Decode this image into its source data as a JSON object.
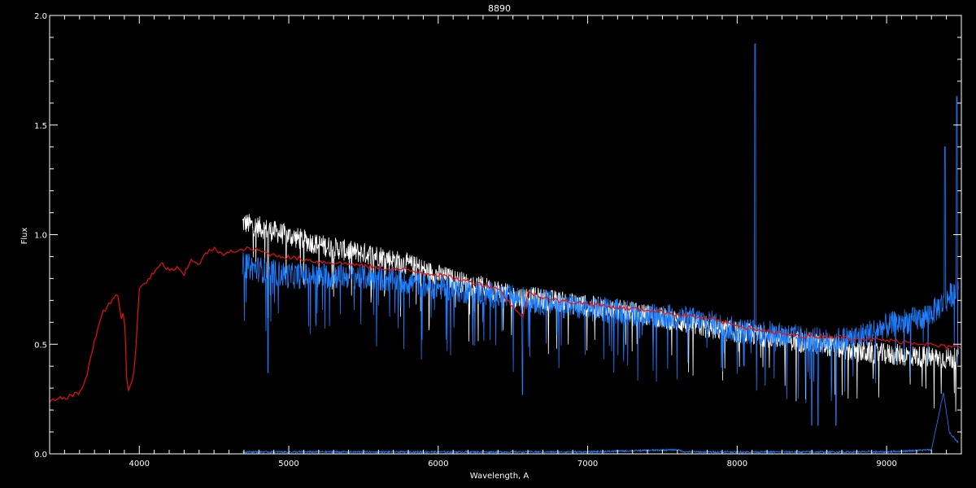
{
  "chart_data": {
    "type": "line",
    "title": "8890",
    "xlabel": "Wavelength, A",
    "ylabel": "Flux",
    "xlim": [
      3400,
      9500
    ],
    "ylim": [
      0.0,
      2.0
    ],
    "x_ticks": [
      "4000",
      "5000",
      "6000",
      "7000",
      "8000",
      "9000"
    ],
    "y_ticks": [
      "0.0",
      "0.5",
      "1.0",
      "1.5",
      "2.0"
    ],
    "grid": false,
    "background_color": "#000000",
    "foreground_color": "#ffffff",
    "series": [
      {
        "key": "white",
        "color": "#ffffff",
        "x": [
          4690,
          4800,
          5000,
          5200,
          5400,
          5600,
          5800,
          6000,
          6200,
          6400,
          6500,
          6600,
          6700,
          6800,
          7000,
          7200,
          7400,
          7600,
          7800,
          8000,
          8200,
          8400,
          8600,
          8800,
          9000,
          9200,
          9400,
          9480
        ],
        "y": [
          1.07,
          1.05,
          1.01,
          0.97,
          0.94,
          0.92,
          0.88,
          0.83,
          0.79,
          0.76,
          0.73,
          0.73,
          0.72,
          0.71,
          0.69,
          0.67,
          0.65,
          0.62,
          0.59,
          0.57,
          0.55,
          0.53,
          0.51,
          0.48,
          0.47,
          0.46,
          0.45,
          0.45
        ],
        "noise": 0.05,
        "dips": [
          [
            4861,
            0.62
          ],
          [
            6563,
            0.64
          ]
        ]
      },
      {
        "key": "blue",
        "color": "#1e7fff",
        "x": [
          4690,
          4800,
          5000,
          5200,
          5400,
          5600,
          5800,
          6000,
          6200,
          6400,
          6600,
          6800,
          7000,
          7200,
          7400,
          7600,
          7800,
          8000,
          8200,
          8400,
          8600,
          8800,
          9000,
          9100,
          9200,
          9300,
          9400,
          9480
        ],
        "y": [
          0.88,
          0.86,
          0.83,
          0.83,
          0.83,
          0.82,
          0.8,
          0.78,
          0.76,
          0.74,
          0.72,
          0.7,
          0.68,
          0.67,
          0.65,
          0.64,
          0.62,
          0.58,
          0.57,
          0.55,
          0.53,
          0.55,
          0.6,
          0.62,
          0.63,
          0.66,
          0.72,
          0.78
        ],
        "noise": 0.06,
        "dips": [
          [
            4861,
            0.37
          ],
          [
            6563,
            0.27
          ],
          [
            8498,
            0.13
          ],
          [
            8542,
            0.13
          ],
          [
            8662,
            0.13
          ]
        ],
        "spikes": [
          [
            8120,
            1.87
          ],
          [
            9390,
            1.4
          ],
          [
            9470,
            1.63
          ]
        ]
      },
      {
        "key": "red",
        "color": "#e81010",
        "x": [
          3400,
          3500,
          3600,
          3650,
          3700,
          3750,
          3800,
          3850,
          3880,
          3900,
          3920,
          3950,
          3970,
          4000,
          4050,
          4100,
          4150,
          4200,
          4250,
          4300,
          4350,
          4400,
          4450,
          4500,
          4550,
          4600,
          4650,
          4700,
          4800,
          4900,
          5000,
          5200,
          5400,
          5600,
          5800,
          6000,
          6200,
          6400,
          6563,
          6600,
          6800,
          7000,
          7200,
          7400,
          7600,
          7800,
          8000,
          8200,
          8400,
          8600,
          8800,
          9000,
          9200,
          9400,
          9500
        ],
        "y": [
          0.24,
          0.26,
          0.28,
          0.36,
          0.52,
          0.64,
          0.69,
          0.74,
          0.62,
          0.66,
          0.27,
          0.33,
          0.4,
          0.76,
          0.79,
          0.83,
          0.87,
          0.84,
          0.85,
          0.82,
          0.89,
          0.87,
          0.92,
          0.94,
          0.91,
          0.93,
          0.92,
          0.94,
          0.93,
          0.91,
          0.9,
          0.88,
          0.87,
          0.85,
          0.84,
          0.82,
          0.79,
          0.76,
          0.62,
          0.74,
          0.7,
          0.69,
          0.67,
          0.66,
          0.64,
          0.62,
          0.59,
          0.56,
          0.54,
          0.54,
          0.53,
          0.52,
          0.51,
          0.49,
          0.49
        ],
        "noise": 0.01
      },
      {
        "key": "baseline",
        "color": "#1e7fff",
        "x": [
          4690,
          5000,
          6000,
          7000,
          7600,
          7650,
          8000,
          9000,
          9300,
          9380,
          9420,
          9480
        ],
        "y": [
          0.01,
          0.01,
          0.01,
          0.01,
          0.02,
          0.01,
          0.01,
          0.01,
          0.02,
          0.28,
          0.1,
          0.05
        ],
        "noise": 0.004
      }
    ]
  }
}
